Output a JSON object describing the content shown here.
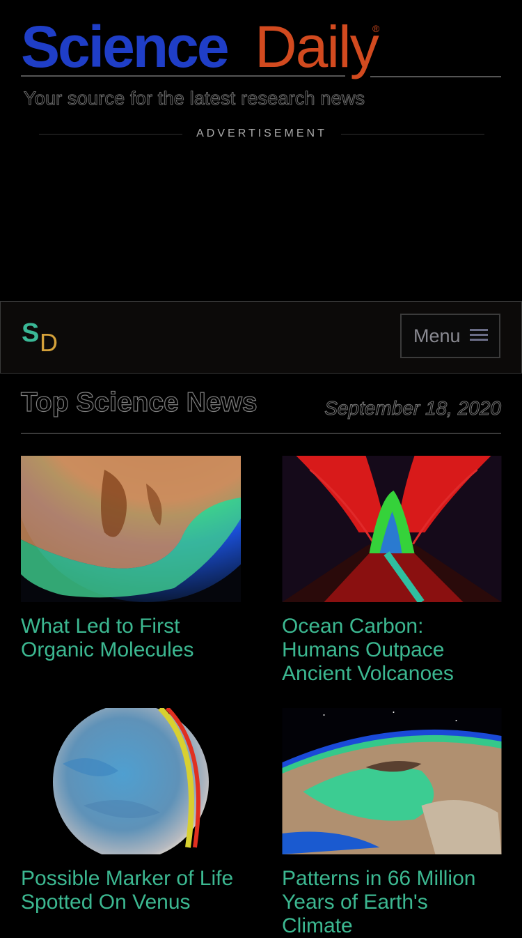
{
  "header": {
    "logo_science": "Science",
    "logo_daily": "Daily",
    "logo_registered": "®",
    "tagline": "Your source for the latest research news",
    "advertisement_label": "ADVERTISEMENT"
  },
  "navbar": {
    "logo_s": "S",
    "logo_d": "D",
    "menu_label": "Menu",
    "menu_icon": "hamburger-icon"
  },
  "section": {
    "title": "Top Science News",
    "date": "September 18, 2020"
  },
  "stories": [
    {
      "headline": "What Led to First Organic Molecules",
      "image": "planet-surface-thermal-image"
    },
    {
      "headline": "Ocean Carbon: Humans Outpace Ancient Volcanoes",
      "image": "erupting-volcano-image"
    },
    {
      "headline": "Possible Marker of Life Spotted On Venus",
      "image": "venus-planet-image"
    },
    {
      "headline": "Patterns in 66 Million Years of Earth's Climate",
      "image": "earth-from-orbit-image"
    }
  ],
  "colors": {
    "brand_blue": "#1f3ec7",
    "brand_orange": "#d24a1f",
    "headline_green": "#3cb891",
    "sd_green": "#3ab896",
    "sd_gold": "#d4a13a"
  }
}
